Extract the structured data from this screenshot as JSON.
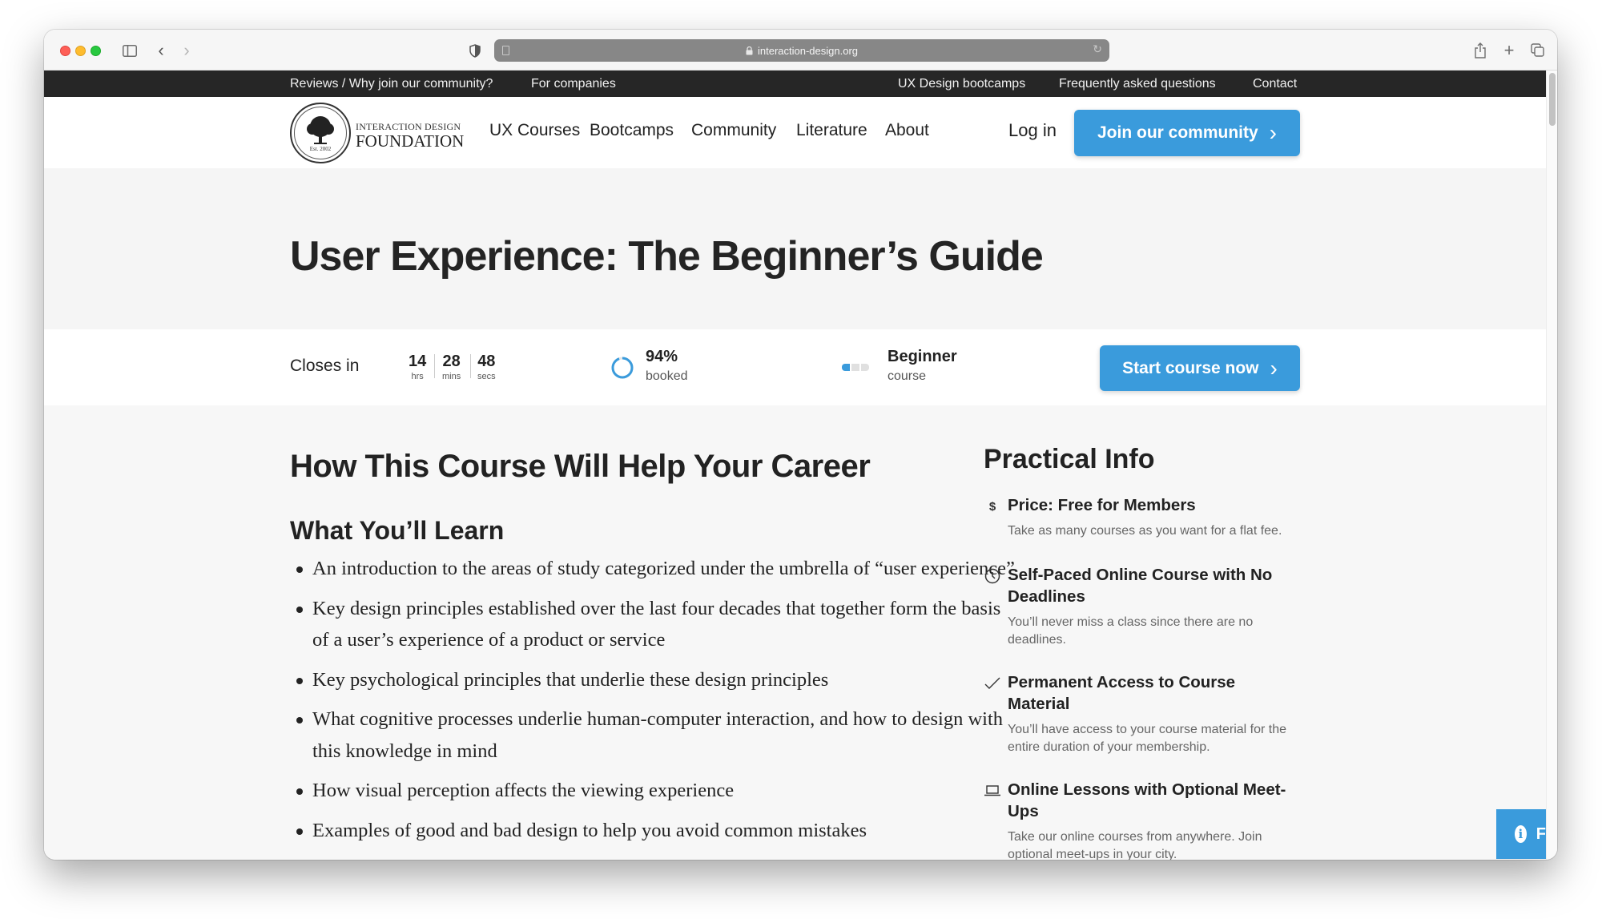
{
  "browser": {
    "url": "interaction-design.org",
    "icons": [
      "sidebar-icon",
      "back-icon",
      "forward-icon",
      "shield-icon",
      "lock-icon",
      "reload-icon",
      "share-icon",
      "new-tab-icon",
      "tab-overview-icon"
    ]
  },
  "topbar": {
    "left_links": [
      "Reviews / Why join our community?",
      "For companies"
    ],
    "right_links": [
      "UX Design bootcamps",
      "Frequently asked questions",
      "Contact"
    ]
  },
  "nav": {
    "logo_line1": "INTERACTION DESIGN",
    "logo_line2": "FOUNDATION",
    "logo_est": "Est. 2002",
    "links": [
      "UX Courses",
      "Bootcamps",
      "Community",
      "Literature",
      "About"
    ],
    "login": "Log in",
    "join_button": "Join our community",
    "chevron": "›"
  },
  "course": {
    "title": "User Experience: The Beginner’s Guide",
    "closes_label": "Closes in",
    "countdown": [
      {
        "value": "14",
        "unit": "hrs"
      },
      {
        "value": "28",
        "unit": "mins"
      },
      {
        "value": "48",
        "unit": "secs"
      }
    ],
    "booked_percent": 94,
    "booked_value": "94%",
    "booked_label": "booked",
    "level": "Beginner",
    "level_label": "course",
    "level_fraction": "1/3",
    "start_button": "Start course now"
  },
  "main": {
    "heading": "How This Course Will Help Your Career",
    "subheading": "What You’ll Learn",
    "learn_items": [
      "An introduction to the areas of study categorized under the umbrella of “user experience”",
      "Key design principles established over the last four decades that together form the basis of a user’s experience of a product or service",
      "Key psychological principles that underlie these design principles",
      "What cognitive processes underlie human-computer interaction, and how to design with this knowledge in mind",
      "How visual perception affects the viewing experience",
      "Examples of good and bad design to help you avoid common mistakes"
    ]
  },
  "practical_info": {
    "title": "Practical Info",
    "items": [
      {
        "icon": "dollar-icon",
        "glyph": "$",
        "title": "Price: Free for Members",
        "desc": "Take as many courses as you want for a flat fee."
      },
      {
        "icon": "clock-icon",
        "glyph": "",
        "title": "Self-Paced Online Course with No Deadlines",
        "desc": "You’ll never miss a class since there are no deadlines."
      },
      {
        "icon": "check-icon",
        "glyph": "✓",
        "title": "Permanent Access to Course Material",
        "desc": "You’ll have access to your course material for the entire duration of your membership."
      },
      {
        "icon": "laptop-icon",
        "glyph": "",
        "title": "Online Lessons with Optional Meet-Ups",
        "desc": "Take our online courses from anywhere. Join optional meet-ups in your city."
      }
    ]
  },
  "feedback": {
    "icon": "info-icon",
    "glyph": "i",
    "label": "F"
  },
  "colors": {
    "accent": "#3a9bdc",
    "topbar": "#262626",
    "text": "#222222"
  }
}
